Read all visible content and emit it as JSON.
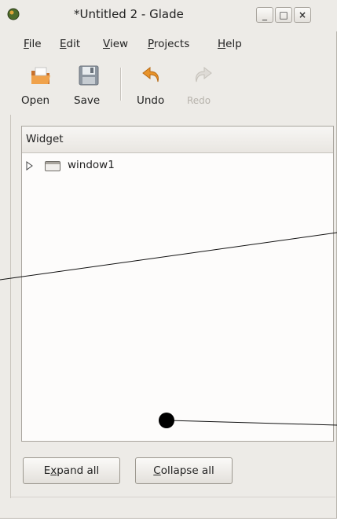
{
  "window": {
    "title": "*Untitled 2 - Glade",
    "controls": {
      "minimize": "_",
      "maximize": "□",
      "close": "×"
    }
  },
  "menu": [
    {
      "mnemonic": "F",
      "rest": "ile"
    },
    {
      "mnemonic": "E",
      "rest": "dit"
    },
    {
      "mnemonic": "V",
      "rest": "iew"
    },
    {
      "mnemonic": "P",
      "rest": "rojects"
    },
    {
      "mnemonic": "H",
      "rest": "elp"
    }
  ],
  "toolbar": {
    "open": "Open",
    "save": "Save",
    "undo": "Undo",
    "redo": "Redo"
  },
  "tree": {
    "column_header": "Widget",
    "rows": [
      {
        "label": "window1",
        "icon": "window-icon",
        "expanded": false
      }
    ]
  },
  "buttons": {
    "expand": {
      "pre": "E",
      "mnemonic": "x",
      "post": "pand all"
    },
    "collapse": {
      "pre": "",
      "mnemonic": "C",
      "post": "ollapse all"
    }
  },
  "colors": {
    "window_bg": "#edebe7",
    "undo_arrow": "#e8932a",
    "open_folder": "#e08a2e"
  }
}
